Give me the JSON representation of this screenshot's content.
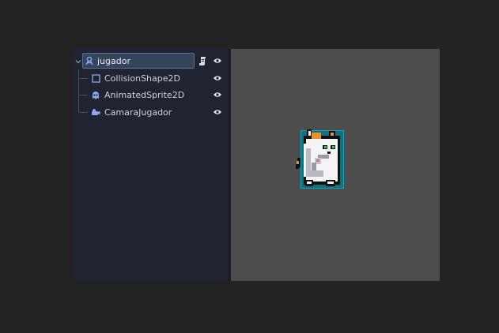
{
  "scene_tree": {
    "root": {
      "label": "jugador",
      "icon": "node-2d-icon",
      "selected": true,
      "has_script": true,
      "visible": true
    },
    "children": [
      {
        "label": "CollisionShape2D",
        "icon": "collision-shape-icon",
        "visible": true
      },
      {
        "label": "AnimatedSprite2D",
        "icon": "animated-sprite-icon",
        "visible": true
      },
      {
        "label": "CamaraJugador",
        "icon": "camera-icon",
        "visible": true
      }
    ]
  },
  "colors": {
    "panel_bg": "#1f2430",
    "viewport_bg": "#4d4d4d",
    "selection_bg": "#34455c",
    "node_icon_blue": "#8da5f3",
    "collision_outline": "#17a2b8"
  },
  "viewport": {
    "sprite": "cat-character-sprite"
  }
}
